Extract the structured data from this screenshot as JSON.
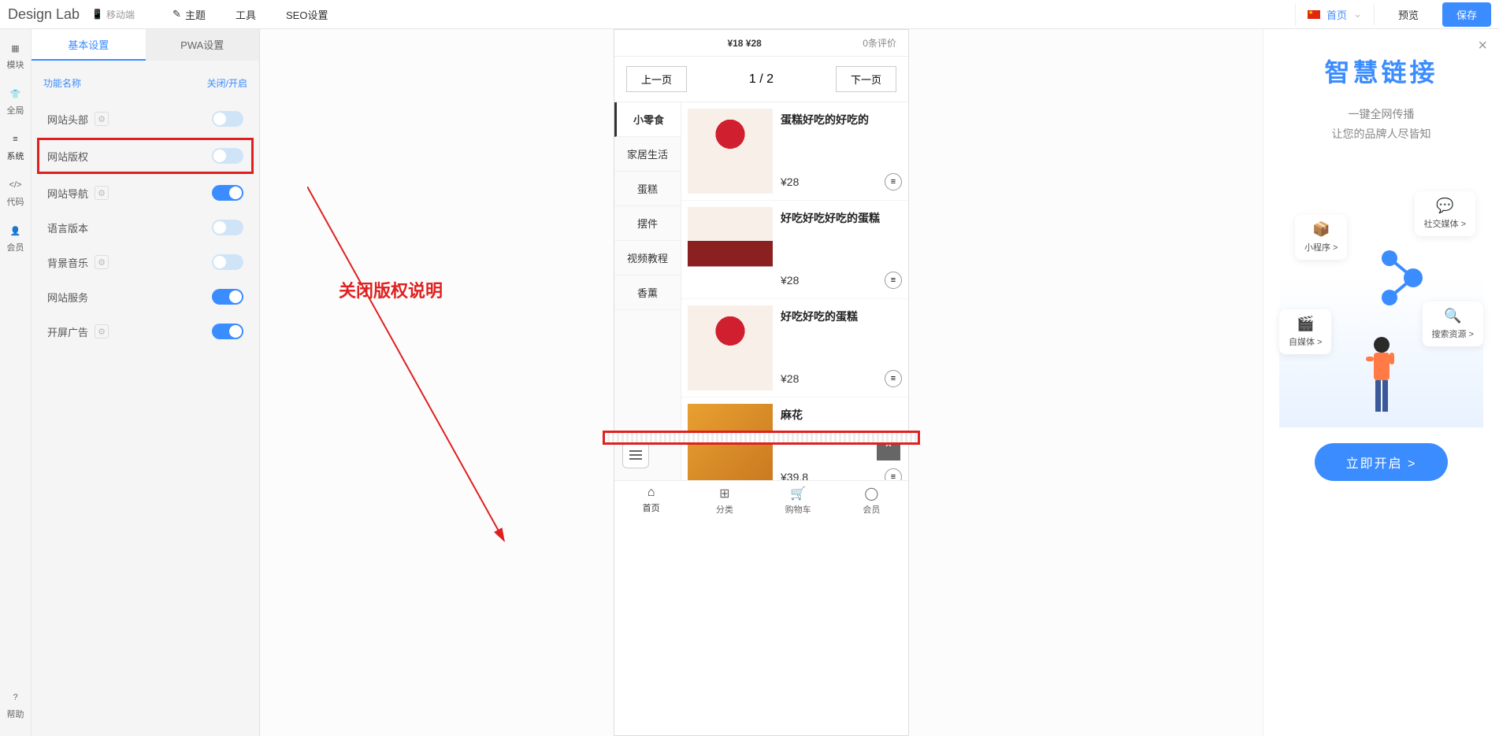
{
  "topbar": {
    "logo": "Design Lab",
    "mobile": "移动端",
    "nav": [
      "主题",
      "工具",
      "SEO设置"
    ],
    "page_label": "首页",
    "preview": "预览",
    "save": "保存"
  },
  "rail": {
    "items": [
      "模块",
      "全局",
      "系统",
      "代码",
      "会员"
    ],
    "help": "帮助"
  },
  "settings": {
    "tabs": [
      "基本设置",
      "PWA设置"
    ],
    "header_left": "功能名称",
    "header_right": "关闭/开启",
    "rows": [
      {
        "label": "网站头部",
        "gear": true,
        "on": false
      },
      {
        "label": "网站版权",
        "gear": false,
        "on": false,
        "hl": true
      },
      {
        "label": "网站导航",
        "gear": true,
        "on": true
      },
      {
        "label": "语言版本",
        "gear": false,
        "on": false
      },
      {
        "label": "背景音乐",
        "gear": true,
        "on": false
      },
      {
        "label": "网站服务",
        "gear": false,
        "on": true
      },
      {
        "label": "开屏广告",
        "gear": true,
        "on": true
      }
    ]
  },
  "annotation": "关闭版权说明",
  "phone": {
    "top_price": "¥18 ¥28",
    "top_reviews": "0条评价",
    "prev": "上一页",
    "pager": "1 / 2",
    "next": "下一页",
    "categories": [
      "小零食",
      "家居生活",
      "蛋糕",
      "摆件",
      "视频教程",
      "香薰"
    ],
    "products": [
      {
        "name": "蛋糕好吃的好吃的",
        "price": "¥28",
        "img": "cupcake"
      },
      {
        "name": "好吃好吃好吃的蛋糕",
        "price": "¥28",
        "img": "cake"
      },
      {
        "name": "好吃好吃的蛋糕",
        "price": "¥28",
        "img": "cupcake"
      },
      {
        "name": "麻花",
        "price": "¥39.8",
        "img": "waffle"
      }
    ],
    "tabs": [
      {
        "label": "首页",
        "icon": "⌂"
      },
      {
        "label": "分类",
        "icon": "⊞"
      },
      {
        "label": "购物车",
        "icon": "🛒"
      },
      {
        "label": "会员",
        "icon": "◯"
      }
    ]
  },
  "right": {
    "title": "智慧链接",
    "sub1": "一键全网传播",
    "sub2": "让您的品牌人尽皆知",
    "cards": [
      {
        "label": "社交媒体 >",
        "icon": "💬",
        "color": "#ff7a45"
      },
      {
        "label": "小程序 >",
        "icon": "📦",
        "color": "#3b8cff"
      },
      {
        "label": "自媒体 >",
        "icon": "🎬",
        "color": "#ff4d8f"
      },
      {
        "label": "搜索资源 >",
        "icon": "🔍",
        "color": "#3b8cff"
      }
    ],
    "cta": "立即开启 >"
  }
}
